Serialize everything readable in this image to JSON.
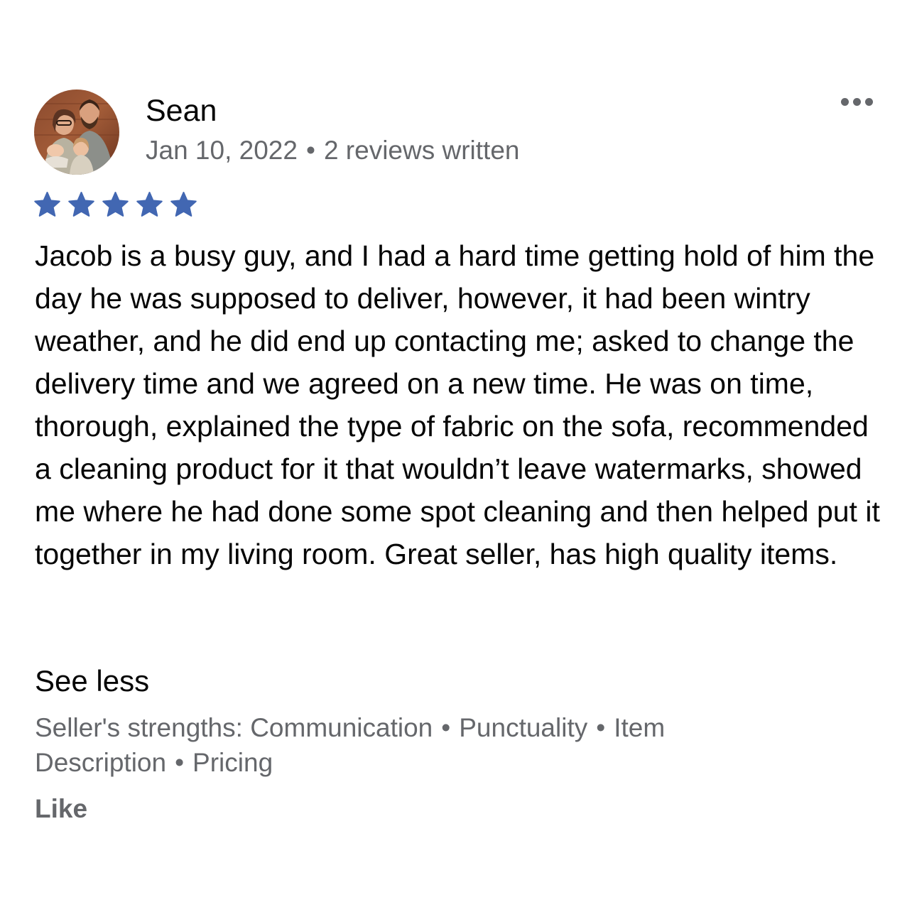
{
  "review": {
    "reviewer_name": "Sean",
    "date": "Jan 10, 2022",
    "separator": "•",
    "reviews_written": "2 reviews written",
    "rating": 5,
    "rating_max": 5,
    "star_color": "#4267B2",
    "text": "Jacob is a busy guy, and I had a hard time getting hold of him the day he was supposed to deliver, however, it had been wintry weather, and he did end up contacting me; asked to change the delivery time and we agreed on a new time. He was on time, thorough, explained the type of fabric on the sofa, recommended a cleaning product for it that wouldn’t leave watermarks, showed me where he had done some spot cleaning and then helped put it together in my living room. Great seller, has high quality items.",
    "see_less_label": "See less",
    "strengths_prefix": "Seller's strengths:",
    "strengths": [
      "Communication",
      "Punctuality",
      "Item Description",
      "Pricing"
    ],
    "like_label": "Like",
    "more_icon": "more-horizontal-icon",
    "avatar_icon": "profile-photo"
  }
}
